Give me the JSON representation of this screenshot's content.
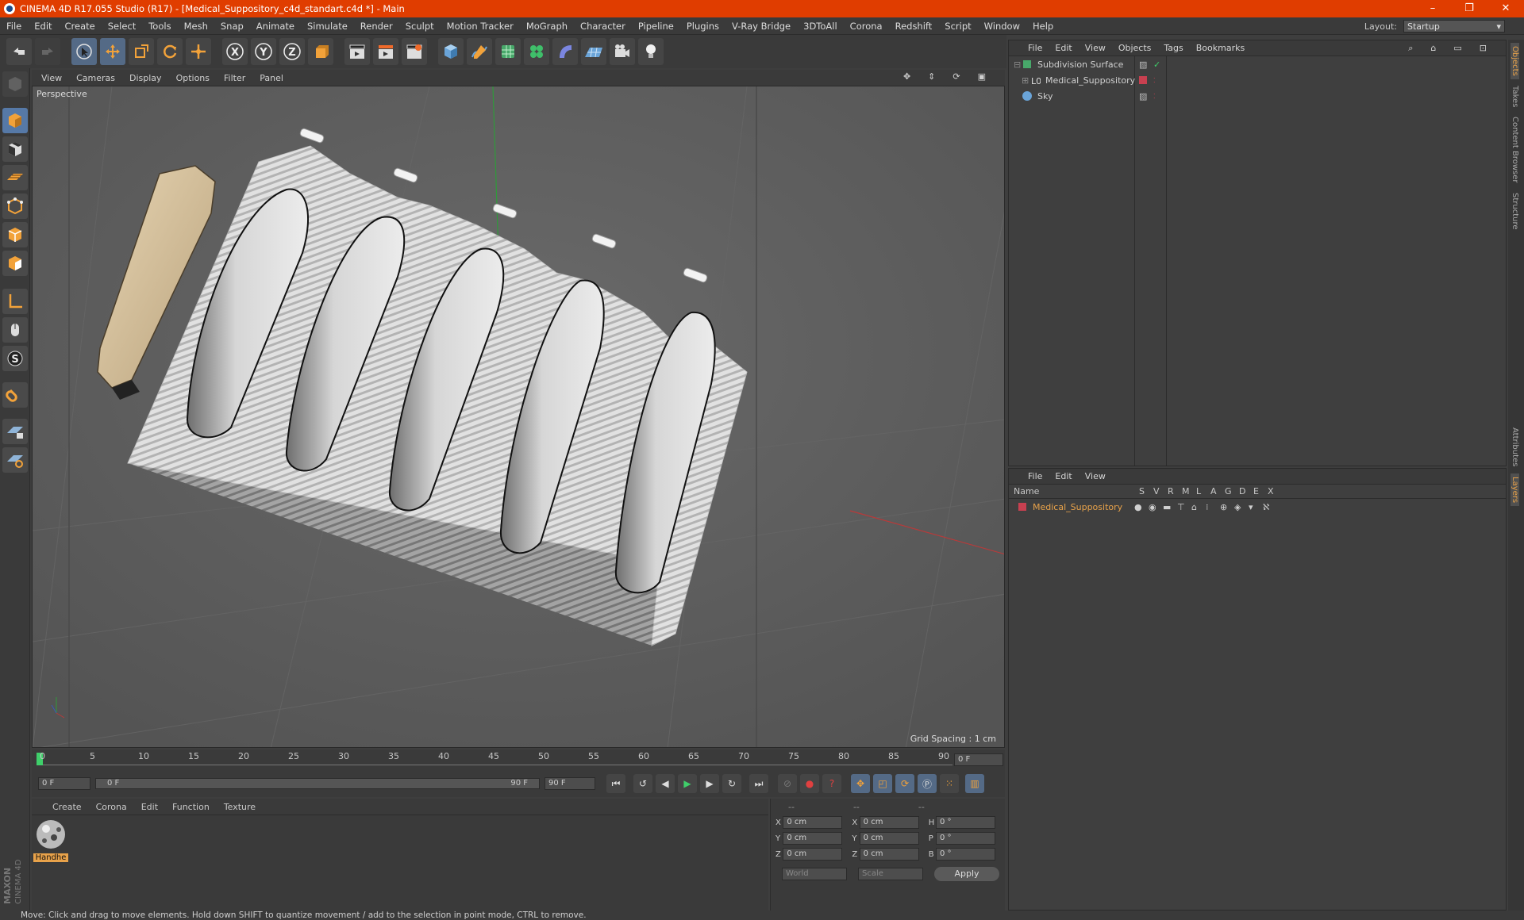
{
  "window": {
    "title": "CINEMA 4D R17.055 Studio (R17) - [Medical_Suppository_c4d_standart.c4d *] - Main",
    "controls": [
      "–",
      "❐",
      "✕"
    ]
  },
  "menubar": {
    "items": [
      "File",
      "Edit",
      "Create",
      "Select",
      "Tools",
      "Mesh",
      "Snap",
      "Animate",
      "Simulate",
      "Render",
      "Sculpt",
      "Motion Tracker",
      "MoGraph",
      "Character",
      "Pipeline",
      "Plugins",
      "V-Ray Bridge",
      "3DToAll",
      "Corona",
      "Redshift",
      "Script",
      "Window",
      "Help"
    ],
    "layout_label": "Layout:",
    "layout_value": "Startup"
  },
  "viewport": {
    "menu": [
      "View",
      "Cameras",
      "Display",
      "Options",
      "Filter",
      "Panel"
    ],
    "camera_label": "Perspective",
    "grid_spacing": "Grid Spacing : 1 cm"
  },
  "timeline": {
    "ticks": [
      "0",
      "5",
      "10",
      "15",
      "20",
      "25",
      "30",
      "35",
      "40",
      "45",
      "50",
      "55",
      "60",
      "65",
      "70",
      "75",
      "80",
      "85",
      "90"
    ],
    "current_frame": "0 F"
  },
  "transport": {
    "start": "0 F",
    "range_start": "0 F",
    "range_end": "90 F",
    "end": "90 F"
  },
  "materials": {
    "menu": [
      "Create",
      "Corona",
      "Edit",
      "Function",
      "Texture"
    ],
    "items": [
      {
        "name": "Handhe"
      }
    ]
  },
  "coords": {
    "headers": [
      "--",
      "--",
      "--"
    ],
    "rows": [
      {
        "a": "X",
        "av": "0 cm",
        "b": "X",
        "bv": "0 cm",
        "c": "H",
        "cv": "0 °"
      },
      {
        "a": "Y",
        "av": "0 cm",
        "b": "Y",
        "bv": "0 cm",
        "c": "P",
        "cv": "0 °"
      },
      {
        "a": "Z",
        "av": "0 cm",
        "b": "Z",
        "bv": "0 cm",
        "c": "B",
        "cv": "0 °"
      }
    ],
    "mode": "World",
    "type": "Scale",
    "apply": "Apply"
  },
  "object_manager": {
    "menu": [
      "File",
      "Edit",
      "View",
      "Objects",
      "Tags",
      "Bookmarks"
    ],
    "objects": [
      {
        "name": "Subdivision Surface",
        "indent": 0
      },
      {
        "name": "Medical_Suppository",
        "indent": 1
      },
      {
        "name": "Sky",
        "indent": 0
      }
    ]
  },
  "layer_manager": {
    "menu": [
      "File",
      "Edit",
      "View"
    ],
    "columns": [
      "Name",
      "S",
      "V",
      "R",
      "M",
      "L",
      "A",
      "G",
      "D",
      "E",
      "X"
    ],
    "layers": [
      {
        "name": "Medical_Suppository"
      }
    ]
  },
  "side_tabs": [
    "Objects",
    "Takes",
    "Content Browser",
    "Structure",
    "Attributes",
    "Layers"
  ],
  "branding": "MAXON CINEMA 4D",
  "status": "Move: Click and drag to move elements. Hold down SHIFT to quantize movement / add to the selection in point mode, CTRL to remove.",
  "colors": {
    "title_bar": "#e03d00",
    "accent": "#e8a24a",
    "layer_red": "#c84050"
  }
}
